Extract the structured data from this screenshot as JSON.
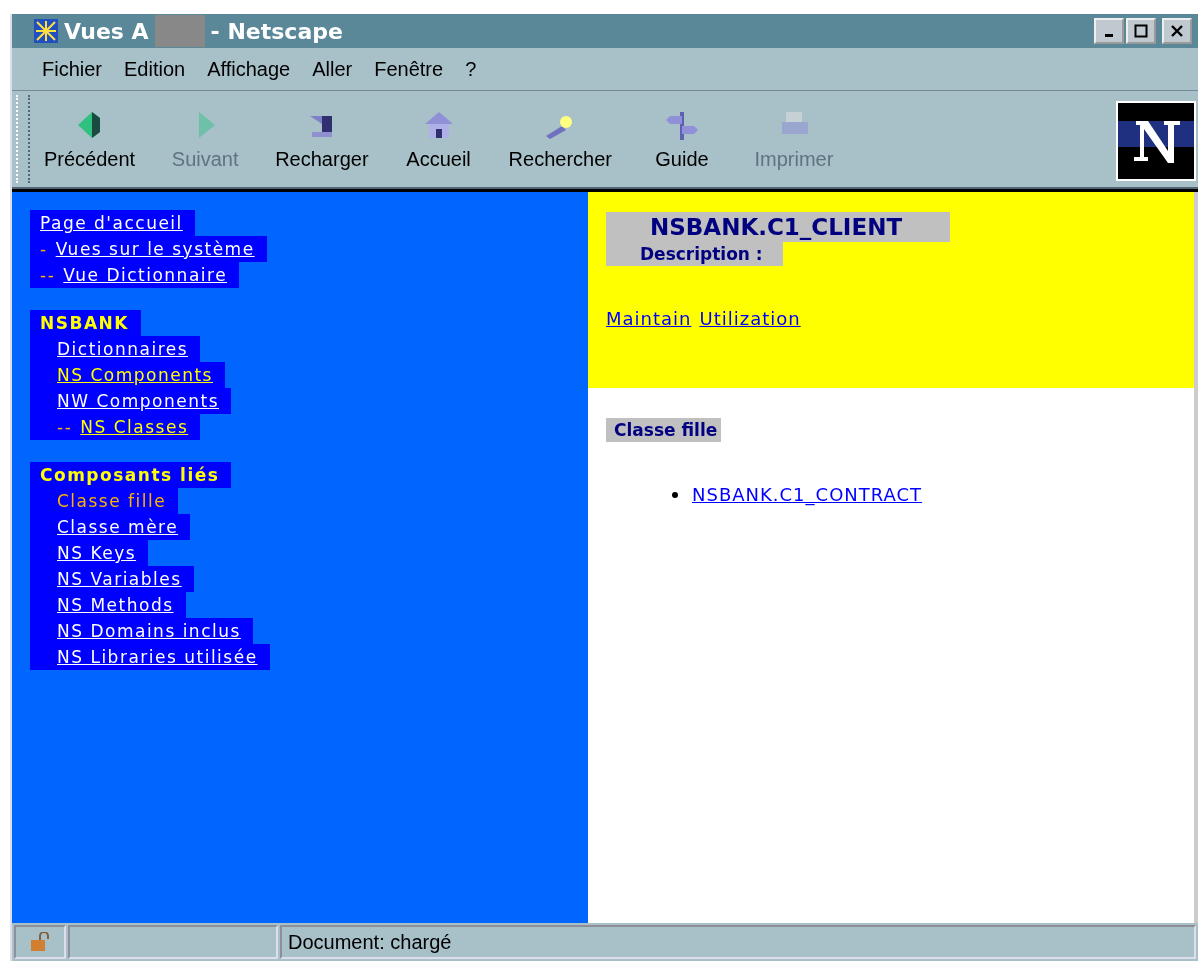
{
  "window": {
    "title_start": "Vues A",
    "title_end": "- Netscape"
  },
  "menu": [
    {
      "label": "Fichier"
    },
    {
      "label": "Edition"
    },
    {
      "label": "Affichage"
    },
    {
      "label": "Aller"
    },
    {
      "label": "Fenêtre"
    },
    {
      "label": "?"
    }
  ],
  "toolbar": [
    {
      "label": "Précédent",
      "disabled": false
    },
    {
      "label": "Suivant",
      "disabled": true
    },
    {
      "label": "Recharger",
      "disabled": false
    },
    {
      "label": "Accueil",
      "disabled": false
    },
    {
      "label": "Rechercher",
      "disabled": false
    },
    {
      "label": "Guide",
      "disabled": false
    },
    {
      "label": "Imprimer",
      "disabled": true
    }
  ],
  "sidebar": {
    "groups": [
      {
        "items": [
          {
            "label": "Page d'accueil",
            "kind": "link"
          },
          {
            "prefix": "-",
            "label": "Vues sur le système",
            "kind": "link"
          },
          {
            "prefix": "--",
            "label": "Vue Dictionnaire",
            "kind": "link"
          }
        ]
      },
      {
        "heading": "NSBANK",
        "items": [
          {
            "label": "Dictionnaires",
            "kind": "link"
          },
          {
            "label": "NS Components",
            "kind": "visited"
          },
          {
            "label": "NW Components",
            "kind": "link"
          },
          {
            "prefix": "--",
            "label": "NS Classes",
            "kind": "visited"
          }
        ]
      },
      {
        "heading": "Composants liés",
        "items": [
          {
            "label": "Classe fille",
            "kind": "current"
          },
          {
            "label": "Classe mère",
            "kind": "link"
          },
          {
            "label": "NS Keys",
            "kind": "link"
          },
          {
            "label": "NS Variables",
            "kind": "link"
          },
          {
            "label": "NS Methods",
            "kind": "link"
          },
          {
            "label": "NS Domains inclus",
            "kind": "link"
          },
          {
            "label": "NS Libraries utilisée",
            "kind": "link"
          }
        ]
      }
    ]
  },
  "content": {
    "title": "NSBANK.C1_CLIENT",
    "description_label": "Description :",
    "links": [
      "Maintain",
      "Utilization"
    ],
    "section": "Classe fille",
    "list": [
      "NSBANK.C1_CONTRACT"
    ]
  },
  "status_bar": {
    "text": "Document: chargé"
  }
}
